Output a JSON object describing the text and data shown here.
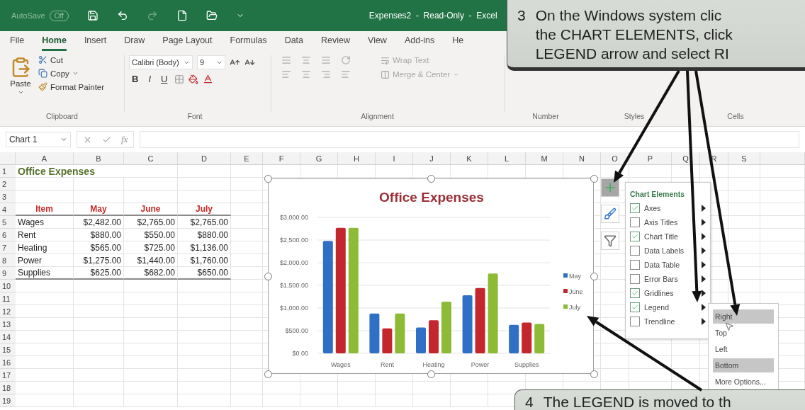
{
  "title_bar": {
    "autosave": {
      "label": "AutoSave",
      "state": "Off",
      "on": false
    },
    "title": "Expenses2  -  Read-Only  -  Excel"
  },
  "menu_tabs": [
    {
      "label": "File",
      "selected": false
    },
    {
      "label": "Home",
      "selected": true
    },
    {
      "label": "Insert",
      "selected": false
    },
    {
      "label": "Draw",
      "selected": false
    },
    {
      "label": "Page Layout",
      "selected": false
    },
    {
      "label": "Formulas",
      "selected": false
    },
    {
      "label": "Data",
      "selected": false
    },
    {
      "label": "Review",
      "selected": false
    },
    {
      "label": "View",
      "selected": false
    },
    {
      "label": "Add-ins",
      "selected": false
    },
    {
      "label": "He",
      "selected": false
    }
  ],
  "ribbon": {
    "clipboard": {
      "paste": "Paste",
      "cut": "Cut",
      "copy": "Copy",
      "format_painter": "Format Painter"
    },
    "font": {
      "name": "Calibri (Body)",
      "size": "9",
      "bold": "B",
      "italic": "I",
      "underline": "U"
    },
    "alignment": {
      "disabled": true,
      "wrap_text": "Wrap Text",
      "merge_center": "Merge & Center"
    },
    "group_labels": [
      "Clipboard",
      "Font",
      "Alignment",
      "Number",
      "Styles",
      "Cells"
    ]
  },
  "formula_bar": {
    "name_box": "Chart 1",
    "function_label": "fx"
  },
  "sheet": {
    "columns": [
      "A",
      "B",
      "C",
      "D",
      "E",
      "F",
      "G",
      "H",
      "I",
      "J",
      "K",
      "L",
      "M",
      "N",
      "O",
      "P",
      "Q",
      "R",
      "S"
    ],
    "rows": [
      {
        "number": "1",
        "kind": "title",
        "cells": [
          "Office Expenses"
        ]
      },
      {
        "number": "2"
      },
      {
        "number": "3"
      },
      {
        "number": "4",
        "kind": "header",
        "cells": [
          "Item",
          "May",
          "June",
          "July"
        ]
      },
      {
        "number": "5",
        "kind": "data",
        "cells": [
          "Wages",
          "$2,482.00",
          "$2,765.00",
          "$2,765.00"
        ]
      },
      {
        "number": "6",
        "kind": "data",
        "cells": [
          "Rent",
          "$880.00",
          "$550.00",
          "$880.00"
        ]
      },
      {
        "number": "7",
        "kind": "data",
        "cells": [
          "Heating",
          "$565.00",
          "$725.00",
          "$1,136.00"
        ]
      },
      {
        "number": "8",
        "kind": "data",
        "cells": [
          "Power",
          "$1,275.00",
          "$1,440.00",
          "$1,760.00"
        ]
      },
      {
        "number": "9",
        "kind": "data",
        "cells": [
          "Supplies",
          "$625.00",
          "$682.00",
          "$650.00"
        ]
      },
      {
        "number": "10"
      },
      {
        "number": "11"
      },
      {
        "number": "12"
      },
      {
        "number": "13"
      },
      {
        "number": "14"
      },
      {
        "number": "15"
      },
      {
        "number": "16"
      },
      {
        "number": "17"
      },
      {
        "number": "18"
      },
      {
        "number": "19"
      }
    ]
  },
  "chart": {
    "chart_data": {
      "type": "bar",
      "title": "Office Expenses",
      "categories": [
        "Wages",
        "Rent",
        "Heating",
        "Power",
        "Supplies"
      ],
      "series": [
        {
          "name": "May",
          "color": "#2f6fc6",
          "values": [
            2480,
            880,
            570,
            1280,
            630
          ]
        },
        {
          "name": "June",
          "color": "#c4262e",
          "values": [
            2770,
            550,
            730,
            1440,
            680
          ]
        },
        {
          "name": "July",
          "color": "#8dbb35",
          "values": [
            2770,
            880,
            1140,
            1760,
            650
          ]
        }
      ],
      "ylim": [
        0,
        3000
      ],
      "grid": true,
      "legend": true,
      "yticks": [
        {
          "value": 0,
          "label": "$0.00"
        },
        {
          "value": 500,
          "label": "$500.00"
        },
        {
          "value": 1000,
          "label": "$1,000.00"
        },
        {
          "value": 1500,
          "label": "$1,500.00"
        },
        {
          "value": 2000,
          "label": "$2,000.00"
        },
        {
          "value": 2500,
          "label": "$2,500.00"
        },
        {
          "value": 3000,
          "label": "$3,000.00"
        }
      ]
    }
  },
  "chart_elements": {
    "title": "Chart Elements",
    "items": [
      {
        "label": "Axes",
        "checked": true
      },
      {
        "label": "Axis Titles",
        "checked": false
      },
      {
        "label": "Chart Title",
        "checked": true
      },
      {
        "label": "Data Labels",
        "checked": false
      },
      {
        "label": "Data Table",
        "checked": false
      },
      {
        "label": "Error Bars",
        "checked": false
      },
      {
        "label": "Gridlines",
        "checked": true
      },
      {
        "label": "Legend",
        "checked": true
      },
      {
        "label": "Trendline",
        "checked": false
      }
    ]
  },
  "legend_menu": {
    "items": [
      {
        "label": "Right",
        "highlighted": true
      },
      {
        "label": "Top",
        "highlighted": false
      },
      {
        "label": "Left",
        "highlighted": false
      },
      {
        "label": "Bottom",
        "highlighted": true
      },
      {
        "label": "More Options...",
        "highlighted": false
      }
    ]
  },
  "top_callout": {
    "number": "3",
    "lines": [
      "On the Windows system clic",
      "the CHART ELEMENTS, click",
      "LEGEND arrow and select RI"
    ]
  },
  "bottom_callout": {
    "number": "4",
    "lines": [
      "The LEGEND is moved to th"
    ]
  }
}
